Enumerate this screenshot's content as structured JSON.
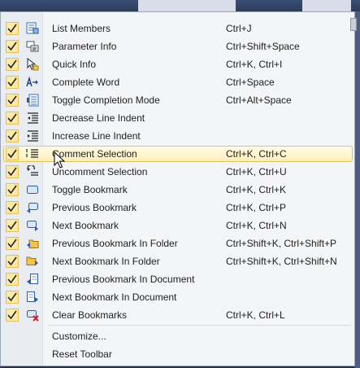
{
  "colors": {
    "check_fill": "#fde9a7",
    "highlight": "#ffefb8",
    "menu_bg": "#f4f5f7"
  },
  "items": [
    {
      "label": "List Members",
      "shortcut": "Ctrl+J",
      "icon": "list-members-icon"
    },
    {
      "label": "Parameter Info",
      "shortcut": "Ctrl+Shift+Space",
      "icon": "parameter-info-icon"
    },
    {
      "label": "Quick Info",
      "shortcut": "Ctrl+K, Ctrl+I",
      "icon": "quick-info-icon"
    },
    {
      "label": "Complete Word",
      "shortcut": "Ctrl+Space",
      "icon": "complete-word-icon"
    },
    {
      "label": "Toggle Completion Mode",
      "shortcut": "Ctrl+Alt+Space",
      "icon": "completion-mode-icon"
    },
    {
      "label": "Decrease Line Indent",
      "shortcut": "",
      "icon": "decrease-indent-icon"
    },
    {
      "label": "Increase Line Indent",
      "shortcut": "",
      "icon": "increase-indent-icon"
    },
    {
      "label": "Comment Selection",
      "shortcut": "Ctrl+K, Ctrl+C",
      "icon": "comment-icon"
    },
    {
      "label": "Uncomment Selection",
      "shortcut": "Ctrl+K, Ctrl+U",
      "icon": "uncomment-icon"
    },
    {
      "label": "Toggle Bookmark",
      "shortcut": "Ctrl+K, Ctrl+K",
      "icon": "bookmark-icon"
    },
    {
      "label": "Previous Bookmark",
      "shortcut": "Ctrl+K, Ctrl+P",
      "icon": "previous-bookmark-icon"
    },
    {
      "label": "Next Bookmark",
      "shortcut": "Ctrl+K, Ctrl+N",
      "icon": "next-bookmark-icon"
    },
    {
      "label": "Previous Bookmark In Folder",
      "shortcut": "Ctrl+Shift+K, Ctrl+Shift+P",
      "icon": "previous-folder-bookmark-icon"
    },
    {
      "label": "Next Bookmark In Folder",
      "shortcut": "Ctrl+Shift+K, Ctrl+Shift+N",
      "icon": "next-folder-bookmark-icon"
    },
    {
      "label": "Previous Bookmark In Document",
      "shortcut": "",
      "icon": "previous-document-bookmark-icon"
    },
    {
      "label": "Next Bookmark In Document",
      "shortcut": "",
      "icon": "next-document-bookmark-icon"
    },
    {
      "label": "Clear Bookmarks",
      "shortcut": "Ctrl+K, Ctrl+L",
      "icon": "clear-bookmarks-icon"
    }
  ],
  "footer": {
    "customize": "Customize...",
    "reset": "Reset Toolbar"
  }
}
